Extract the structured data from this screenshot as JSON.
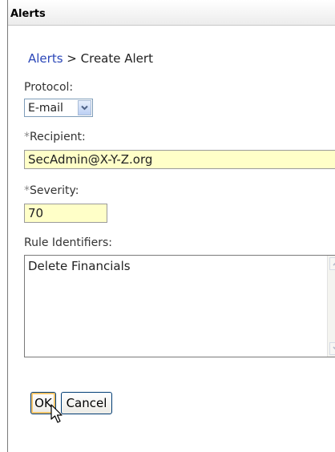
{
  "window": {
    "title": "Alerts"
  },
  "breadcrumb": {
    "parent": "Alerts",
    "separator": " > ",
    "current": "Create Alert"
  },
  "form": {
    "protocol": {
      "label": "Protocol:",
      "selected": "E-mail"
    },
    "recipient": {
      "required_marker": "*",
      "label": "Recipient:",
      "value": "SecAdmin@X-Y-Z.org"
    },
    "severity": {
      "required_marker": "*",
      "label": "Severity:",
      "value": "70"
    },
    "rule_identifiers": {
      "label": "Rule Identifiers:",
      "value": "Delete Financials"
    }
  },
  "buttons": {
    "ok_label": "OK",
    "cancel_label": "Cancel"
  },
  "colors": {
    "required_field_bg": "#ffffc8",
    "link": "#2a46b8"
  },
  "icons": {
    "dropdown": "chevron-down-icon",
    "scroll_up": "scroll-up-arrow-icon",
    "scroll_down": "scroll-down-arrow-icon",
    "pointer": "mouse-pointer-icon"
  }
}
